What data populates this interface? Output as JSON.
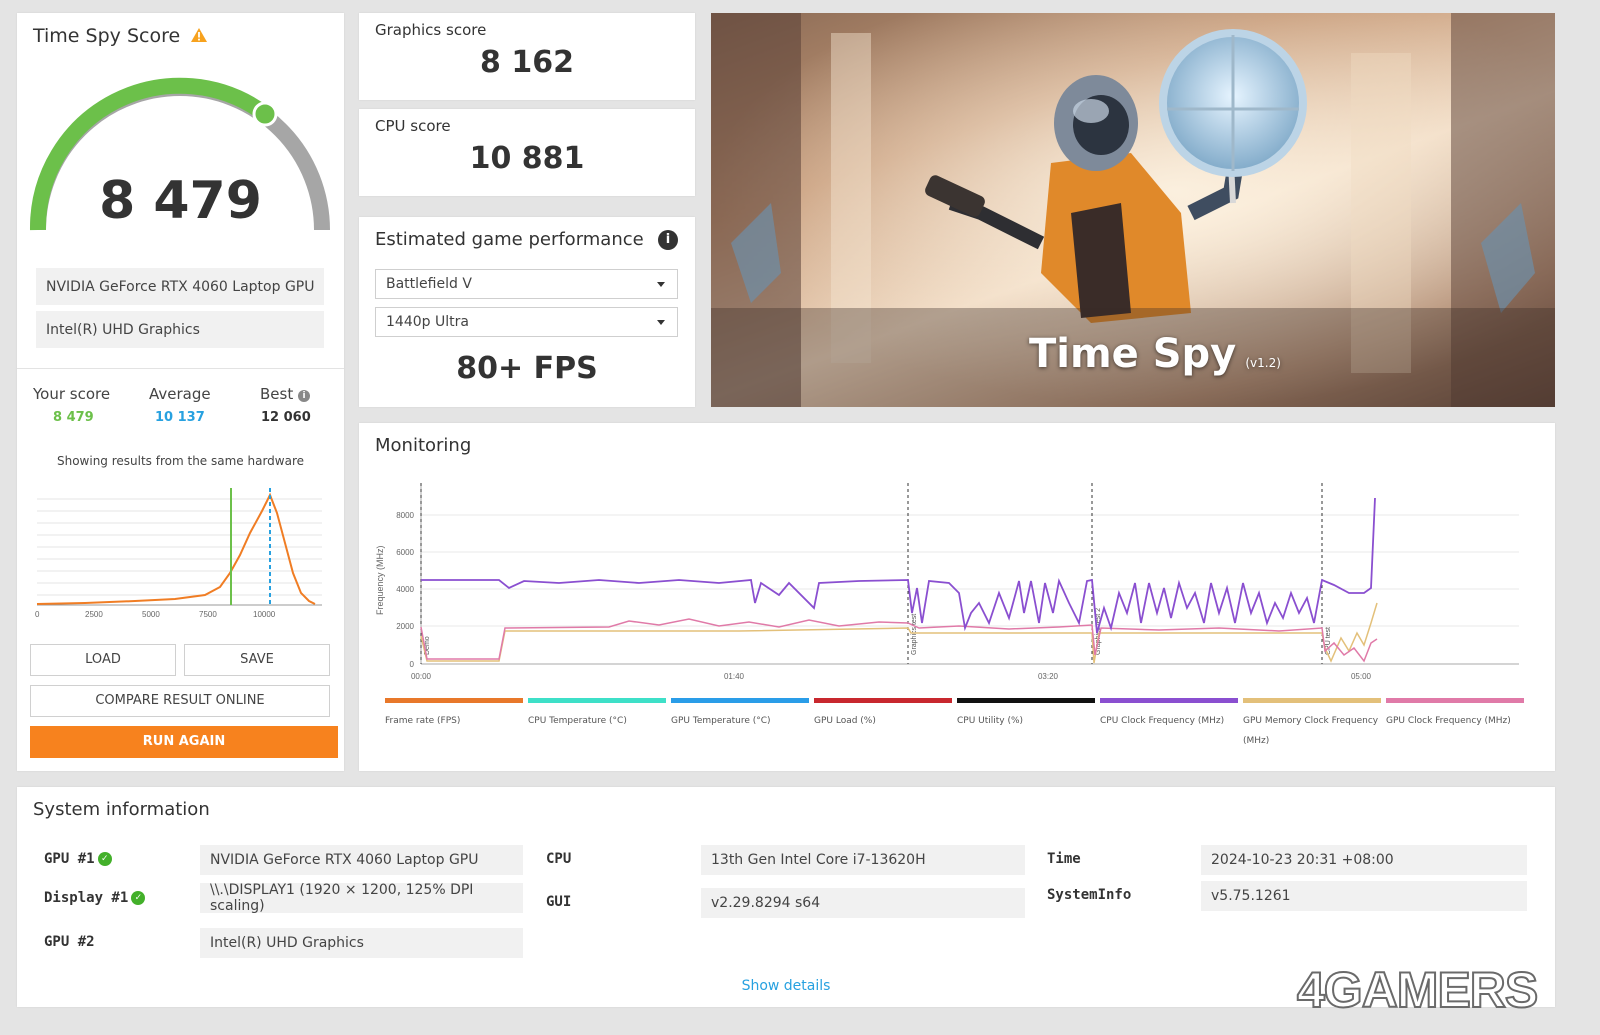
{
  "score_panel": {
    "title": "Time Spy Score",
    "warning_icon": "warning-triangle-icon",
    "score": "8 479",
    "gpu_primary": "NVIDIA GeForce RTX 4060 Laptop GPU",
    "gpu_secondary": "Intel(R) UHD Graphics",
    "compare": {
      "your_label": "Your score",
      "your_value": "8 479",
      "avg_label": "Average",
      "avg_value": "10 137",
      "best_label": "Best",
      "best_value": "12 060"
    },
    "hardware_note": "Showing results from the same hardware",
    "distribution_ticks": [
      "0",
      "2500",
      "5000",
      "7500",
      "10000"
    ],
    "load_label": "LOAD",
    "save_label": "SAVE",
    "compare_label": "COMPARE RESULT ONLINE",
    "run_again_label": "RUN AGAIN"
  },
  "graphics": {
    "label": "Graphics score",
    "value": "8 162"
  },
  "cpu": {
    "label": "CPU score",
    "value": "10 881"
  },
  "estimated": {
    "title": "Estimated game performance",
    "game": "Battlefield V",
    "preset": "1440p Ultra",
    "fps": "80+ FPS"
  },
  "hero": {
    "title": "Time Spy",
    "version": "(v1.2)"
  },
  "monitoring": {
    "title": "Monitoring",
    "y_label": "Frequency (MHz)",
    "y_ticks": [
      "0",
      "2000",
      "4000",
      "6000",
      "8000"
    ],
    "x_ticks": [
      "00:00",
      "01:40",
      "03:20",
      "05:00"
    ],
    "section_markers": [
      "Demo",
      "Graphics test",
      "Graphics test 2",
      "CPU test"
    ],
    "legend": [
      {
        "name": "Frame rate (FPS)",
        "color": "#e8782a"
      },
      {
        "name": "CPU Temperature (°C)",
        "color": "#3ee0c8"
      },
      {
        "name": "GPU Temperature (°C)",
        "color": "#2a9de8"
      },
      {
        "name": "GPU Load (%)",
        "color": "#c8282e"
      },
      {
        "name": "CPU Utility (%)",
        "color": "#111111"
      },
      {
        "name": "CPU Clock Frequency (MHz)",
        "color": "#8a4fd0"
      },
      {
        "name": "GPU Memory Clock Frequency (MHz)",
        "color": "#e3c07a"
      },
      {
        "name": "GPU Clock Frequency (MHz)",
        "color": "#e07aa8"
      }
    ]
  },
  "system": {
    "title": "System information",
    "gpu1_label": "GPU #1",
    "gpu1_value": "NVIDIA GeForce RTX 4060 Laptop GPU",
    "display1_label": "Display #1",
    "display1_value": "\\\\.\\DISPLAY1 (1920 × 1200, 125% DPI scaling)",
    "gpu2_label": "GPU #2",
    "gpu2_value": "Intel(R) UHD Graphics",
    "cpu_label": "CPU",
    "cpu_value": "13th Gen Intel Core i7-13620H",
    "gui_label": "GUI",
    "gui_value": "v2.29.8294 s64",
    "time_label": "Time",
    "time_value": "2024-10-23 20:31 +08:00",
    "sysinfo_label": "SystemInfo",
    "sysinfo_value": "v5.75.1261",
    "show_details": "Show details"
  },
  "watermark": "4GAMERS",
  "colors": {
    "accent": "#f7821e",
    "green": "#6cc04a",
    "blue": "#27a1e0",
    "purple": "#8a4fd0"
  }
}
